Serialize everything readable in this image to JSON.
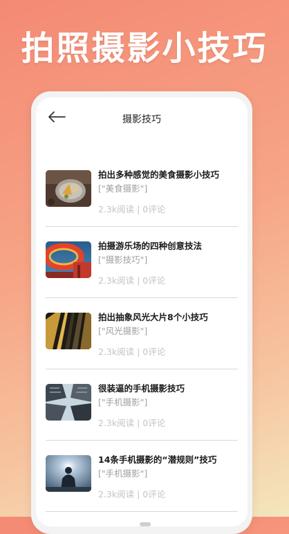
{
  "banner": {
    "title": "拍照摄影小技巧"
  },
  "header": {
    "title": "摄影技巧",
    "back_icon": "back-arrow-icon"
  },
  "articles": [
    {
      "title": "拍出多种感觉的美食摄影小技巧",
      "tag": "[\"美食摄影\"]",
      "meta": "2.3k阅读 | 0评论",
      "thumb": "food-photo"
    },
    {
      "title": "拍摄游乐场的四种创意技法",
      "tag": "[\"摄影技巧\"]",
      "meta": "2.3k阅读 | 0评论",
      "thumb": "amusement-ride-photo"
    },
    {
      "title": "拍出抽象风光大片8个小技巧",
      "tag": "[\"风光摄影\"]",
      "meta": "2.3k阅读 | 0评论",
      "thumb": "abstract-architecture-photo"
    },
    {
      "title": "很装逼的手机摄影技巧",
      "tag": "[\"手机摄影\"]",
      "meta": "2.3k阅读 | 0评论",
      "thumb": "skyscrapers-upward-photo"
    },
    {
      "title": "14条手机摄影的“潜规则”技巧",
      "tag": "[\"手机摄影\"]",
      "meta": "2.3k阅读 | 0评论",
      "thumb": "backlit-silhouette-photo"
    }
  ],
  "colors": {
    "background_top": "#f48a74",
    "background_bottom": "#f3e6bd",
    "title_text": "#1a1a1a",
    "tag_text": "#a0a0a0",
    "meta_text": "#c3c3c3"
  }
}
